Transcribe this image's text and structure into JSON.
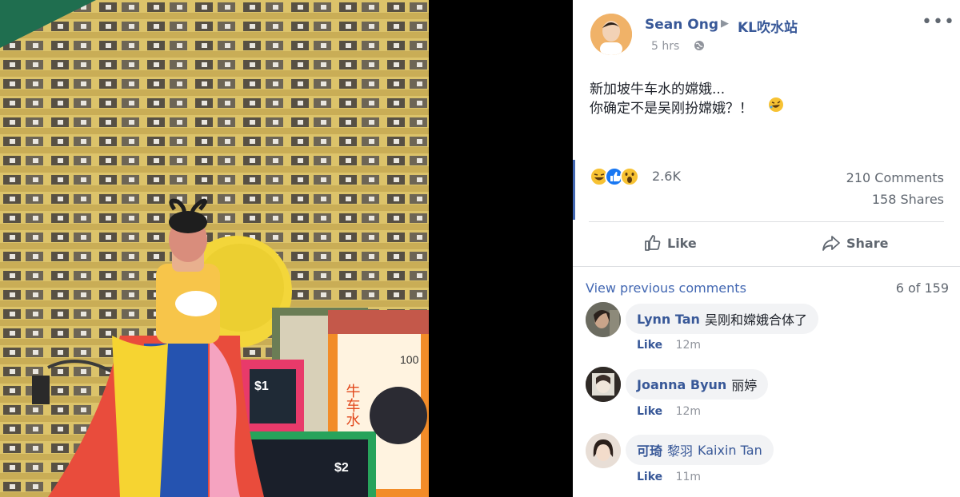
{
  "post": {
    "author": "Sean Ong",
    "group": "KL吹水站",
    "time": "5 hrs",
    "message": [
      "新加坡牛车水的嫦娥...",
      "你确定不是吴刚扮嫦娥？！"
    ],
    "more_label": "•••"
  },
  "stats": {
    "reactions": "2.6K",
    "comments": "210 Comments",
    "shares": "158 Shares"
  },
  "actions": {
    "like": "Like",
    "share": "Share"
  },
  "comments_section": {
    "view_previous": "View previous comments",
    "count": "6 of 159",
    "items": [
      {
        "name": "Lynn Tan",
        "text": "吴刚和嫦娥合体了",
        "like": "Like",
        "time": "12m"
      },
      {
        "name": "Joanna Byun",
        "text": "丽婷",
        "like": "Like",
        "time": "12m"
      },
      {
        "name": "可琦",
        "text": "Kaixin Tan",
        "tag": "黎羽",
        "like": "Like",
        "time": "11m"
      }
    ]
  },
  "photo": {
    "stamp_values": [
      "$1",
      "$2",
      "100"
    ],
    "banner_text": "牛车水"
  },
  "colors": {
    "link_blue": "#385898",
    "action_blue": "#4267b2",
    "grey_text": "#606770",
    "building_yellow": "#d9c06a"
  }
}
